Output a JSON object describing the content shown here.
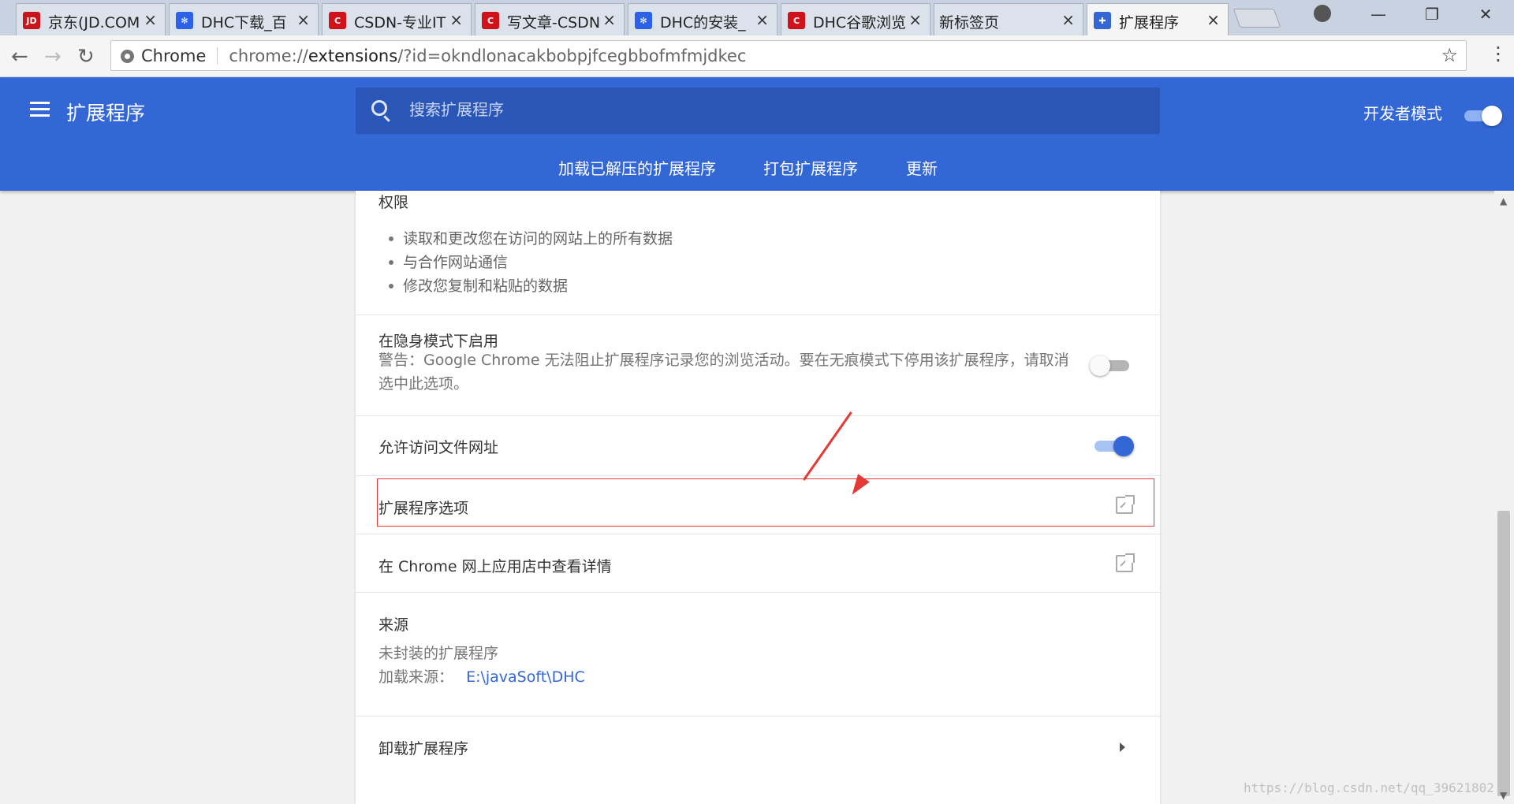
{
  "tabs": [
    {
      "title": "京东(JD.COM",
      "favicon": "JD",
      "favicon_color": "#c8161d"
    },
    {
      "title": "DHC下载_百",
      "favicon": "paw-icon",
      "favicon_color": "#2b62e8"
    },
    {
      "title": "CSDN-专业IT",
      "favicon": "C",
      "favicon_color": "#d0121b"
    },
    {
      "title": "写文章-CSDN",
      "favicon": "C",
      "favicon_color": "#d0121b"
    },
    {
      "title": "DHC的安装_",
      "favicon": "paw-icon",
      "favicon_color": "#2b62e8"
    },
    {
      "title": "DHC谷歌浏览",
      "favicon": "C",
      "favicon_color": "#d0121b"
    },
    {
      "title": "新标签页",
      "favicon": "",
      "favicon_color": ""
    },
    {
      "title": "扩展程序",
      "favicon": "puzzle-icon",
      "favicon_color": "#3367d6"
    }
  ],
  "omnibox": {
    "site": "Chrome",
    "url_prefix": "chrome://",
    "url_host": "extensions",
    "url_rest": "/?id=okndlonacakbobpjfcegbbofmfmjdkec"
  },
  "header": {
    "title": "扩展程序",
    "search_placeholder": "搜索扩展程序",
    "dev_mode_label": "开发者模式",
    "dev_mode_on": true,
    "subnav": [
      "加载已解压的扩展程序",
      "打包扩展程序",
      "更新"
    ]
  },
  "details": {
    "permissions_title": "权限",
    "permissions": [
      "读取和更改您在访问的网站上的所有数据",
      "与合作网站通信",
      "修改您复制和粘贴的数据"
    ],
    "incognito_title": "在隐身模式下启用",
    "incognito_warning_line1": "警告：Google Chrome 无法阻止扩展程序记录您的浏览活动。要在无痕模式下停用该扩展程序，请取消",
    "incognito_warning_line2": "选中此选项。",
    "incognito_on": false,
    "file_access_label": "允许访问文件网址",
    "file_access_on": true,
    "options_label": "扩展程序选项",
    "webstore_label": "在 Chrome 网上应用店中查看详情",
    "source_title": "来源",
    "source_type": "未封装的扩展程序",
    "load_source_label": "加载来源：",
    "load_source_path": "E:\\javaSoft\\DHC",
    "remove_label": "卸载扩展程序"
  },
  "watermark": "https://blog.csdn.net/qq_39621802",
  "colors": {
    "accent": "#3367d6",
    "annotation": "#e53935"
  }
}
